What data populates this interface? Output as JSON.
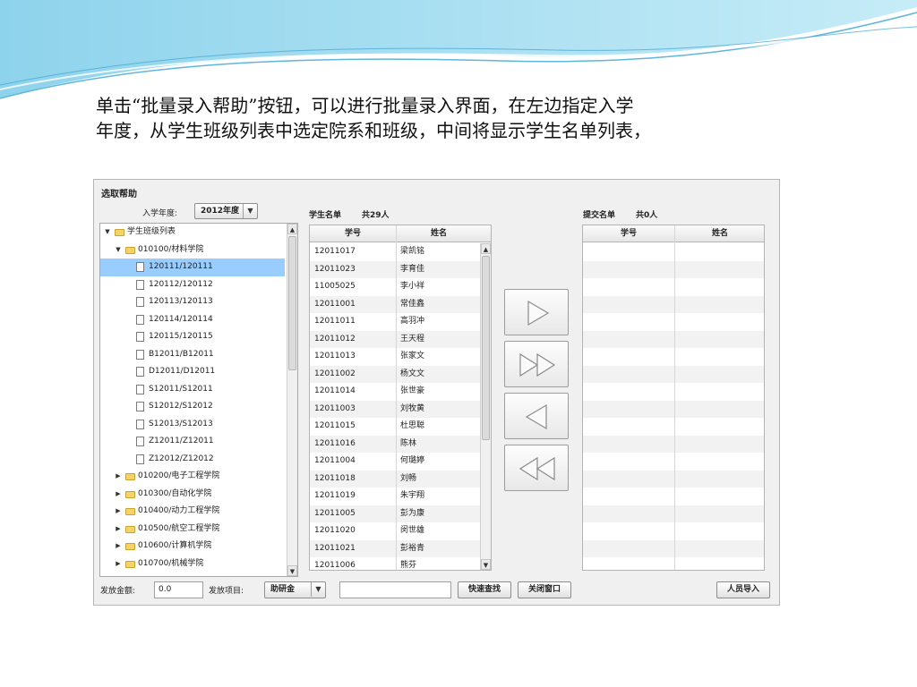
{
  "intro": {
    "line1": "单击“批量录入帮助”按钮，可以进行批量录入界面，在左边指定入学",
    "line2": "年度，从学生班级列表中选定院系和班级，中间将显示学生名单列表，"
  },
  "window": {
    "title": "选取帮助",
    "year_label": "入学年度:",
    "year_value": "2012年度"
  },
  "tree": {
    "root_label": "学生班级列表",
    "expanded_dept": "010100/材料学院",
    "classes": [
      "120111/120111",
      "120112/120112",
      "120113/120113",
      "120114/120114",
      "120115/120115",
      "B12011/B12011",
      "D12011/D12011",
      "S12011/S12011",
      "S12012/S12012",
      "S12013/S12013",
      "Z12011/Z12011",
      "Z12012/Z12012"
    ],
    "selected_class": "120111/120111",
    "other_depts": [
      "010200/电子工程学院",
      "010300/自动化学院",
      "010400/动力工程学院",
      "010500/航空工程学院",
      "010600/计算机学院",
      "010700/机械学院"
    ]
  },
  "student_list": {
    "title": "学生名单",
    "count": "共29人",
    "col_id": "学号",
    "col_name": "姓名",
    "rows": [
      {
        "id": "12011017",
        "name": "梁凯铭"
      },
      {
        "id": "12011023",
        "name": "李育佳"
      },
      {
        "id": "11005025",
        "name": "李小祥"
      },
      {
        "id": "12011001",
        "name": "常佳鑫"
      },
      {
        "id": "12011011",
        "name": "高羽冲"
      },
      {
        "id": "12011012",
        "name": "王天程"
      },
      {
        "id": "12011013",
        "name": "张家文"
      },
      {
        "id": "12011002",
        "name": "杨文文"
      },
      {
        "id": "12011014",
        "name": "张世豪"
      },
      {
        "id": "12011003",
        "name": "刘牧黄"
      },
      {
        "id": "12011015",
        "name": "杜思聪"
      },
      {
        "id": "12011016",
        "name": "陈林"
      },
      {
        "id": "12011004",
        "name": "何璐婷"
      },
      {
        "id": "12011018",
        "name": "刘畅"
      },
      {
        "id": "12011019",
        "name": "朱宇翔"
      },
      {
        "id": "12011005",
        "name": "彭为康"
      },
      {
        "id": "12011020",
        "name": "闵世雄"
      },
      {
        "id": "12011021",
        "name": "彭裕青"
      },
      {
        "id": "12011006",
        "name": "熊芬"
      }
    ]
  },
  "submit_list": {
    "title": "提交名单",
    "count": "共0人",
    "col_id": "学号",
    "col_name": "姓名"
  },
  "transfer_buttons": [
    "move-right",
    "move-all-right",
    "move-left",
    "move-all-left"
  ],
  "bottom": {
    "amount_label": "发放金额:",
    "amount_value": "0.0",
    "item_label": "发放项目:",
    "item_value": "助研金",
    "search_value": "",
    "quick_search": "快速查找",
    "close_window": "关闭窗口",
    "import": "人员导入"
  }
}
